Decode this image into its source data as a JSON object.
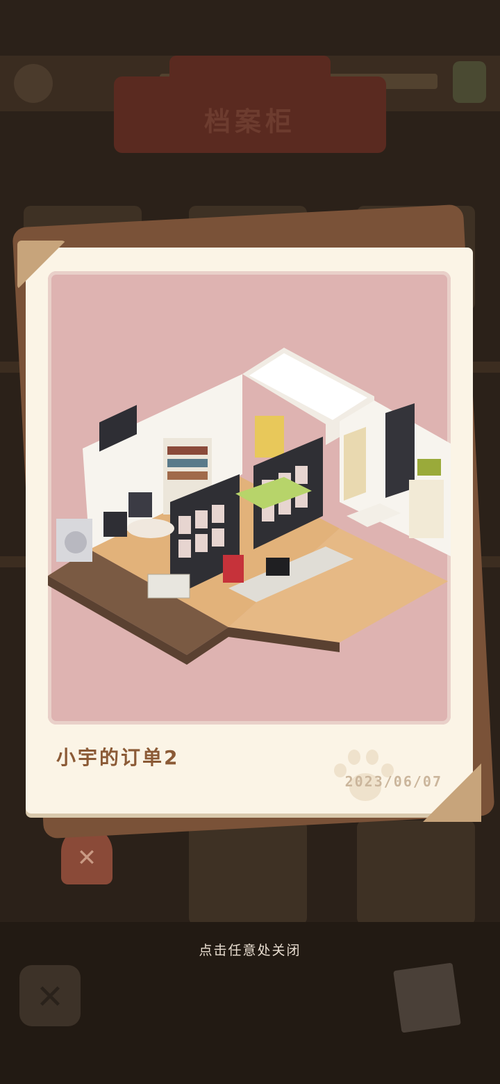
{
  "background": {
    "title": "档案柜",
    "close_glyph": "✕"
  },
  "card": {
    "title": "小宇的订单2",
    "date": "2023/06/07",
    "image_subject": "isometric-room-illustration",
    "colors": {
      "paper": "#fbf4e6",
      "photo_bg": "#deb3b1",
      "title": "#8b5a36",
      "date": "#cbb69c"
    }
  },
  "hint": "点击任意处关闭"
}
